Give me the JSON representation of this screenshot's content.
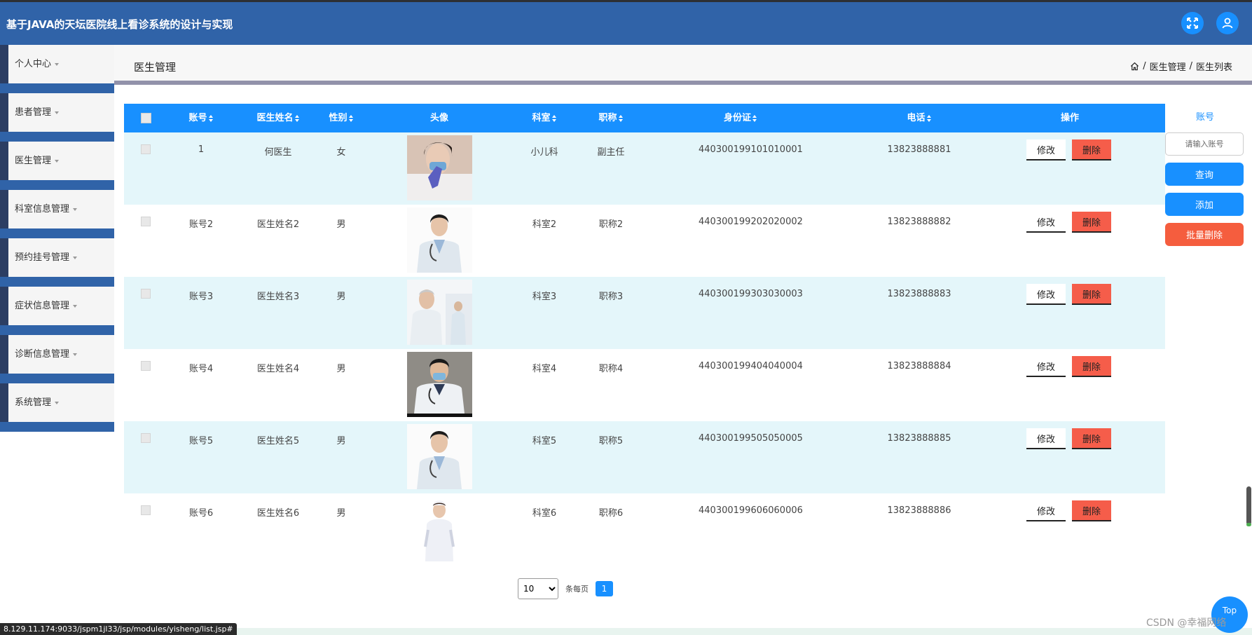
{
  "app": {
    "title": "基于JAVA的天坛医院线上看诊系统的设计与实现"
  },
  "topbar": {
    "fullscreen_icon": "fullscreen-icon",
    "user_icon": "user-icon"
  },
  "sidebar": {
    "items": [
      {
        "label": "个人中心"
      },
      {
        "label": "患者管理"
      },
      {
        "label": "医生管理"
      },
      {
        "label": "科室信息管理"
      },
      {
        "label": "预约挂号管理"
      },
      {
        "label": "症状信息管理"
      },
      {
        "label": "诊断信息管理"
      },
      {
        "label": "系统管理"
      }
    ]
  },
  "header": {
    "title": "医生管理",
    "breadcrumb": [
      "医生管理",
      "医生列表"
    ],
    "breadcrumb_separator": "/"
  },
  "table": {
    "columns": [
      "账号",
      "医生姓名",
      "性别",
      "头像",
      "科室",
      "职称",
      "身份证",
      "电话",
      "操作"
    ],
    "sortable": [
      true,
      true,
      true,
      false,
      true,
      true,
      true,
      true,
      false
    ],
    "rows": [
      {
        "account": "1",
        "name": "何医生",
        "gender": "女",
        "avatar": "female-doctor-mask",
        "dept": "小儿科",
        "title": "副主任",
        "id_card": "440300199101010001",
        "phone": "13823888881"
      },
      {
        "account": "账号2",
        "name": "医生姓名2",
        "gender": "男",
        "avatar": "male-doctor",
        "dept": "科室2",
        "title": "职称2",
        "id_card": "440300199202020002",
        "phone": "13823888882"
      },
      {
        "account": "账号3",
        "name": "医生姓名3",
        "gender": "男",
        "avatar": "senior-doctor-group",
        "dept": "科室3",
        "title": "职称3",
        "id_card": "440300199303030003",
        "phone": "13823888883"
      },
      {
        "account": "账号4",
        "name": "医生姓名4",
        "gender": "男",
        "avatar": "doctor-mask",
        "dept": "科室4",
        "title": "职称4",
        "id_card": "440300199404040004",
        "phone": "13823888884"
      },
      {
        "account": "账号5",
        "name": "医生姓名5",
        "gender": "男",
        "avatar": "male-doctor",
        "dept": "科室5",
        "title": "职称5",
        "id_card": "440300199505050005",
        "phone": "13823888885"
      },
      {
        "account": "账号6",
        "name": "医生姓名6",
        "gender": "男",
        "avatar": "nurse",
        "dept": "科室6",
        "title": "职称6",
        "id_card": "440300199606060006",
        "phone": "13823888886"
      }
    ],
    "edit_label": "修改",
    "delete_label": "删除"
  },
  "search": {
    "label": "账号",
    "placeholder": "请输入账号",
    "query_label": "查询",
    "add_label": "添加",
    "batch_delete_label": "批量删除"
  },
  "pagination": {
    "page_size": "10",
    "per_page_label": "条每页",
    "current_page": "1"
  },
  "misc": {
    "top_button": "Top",
    "status_url": "8.129.11.174:9033/jspm1jl33/jsp/modules/yisheng/list.jsp#",
    "watermark": "CSDN @幸福网络"
  },
  "colors": {
    "topbar": "#3063a8",
    "accent": "#1890ff",
    "danger": "#f55d4a",
    "row_alt": "#e4f6fa"
  }
}
